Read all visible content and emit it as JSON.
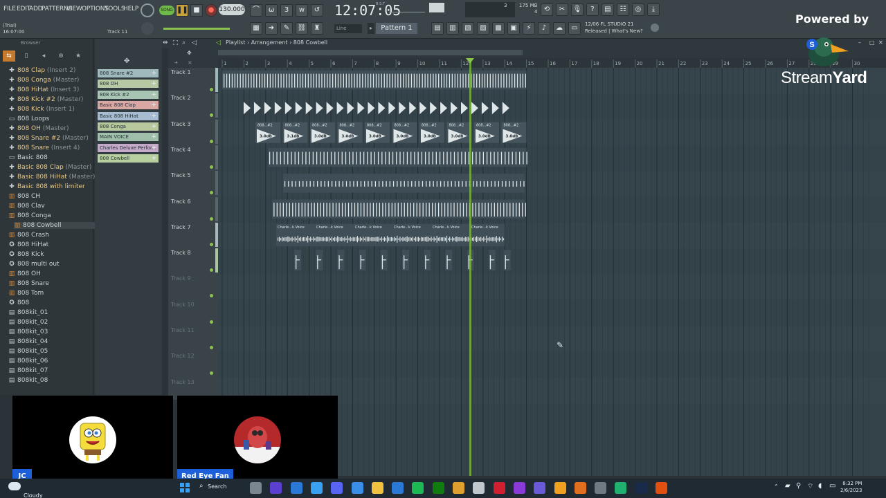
{
  "menu": [
    "FILE",
    "EDIT",
    "ADD",
    "PATTERNS",
    "VIEW",
    "OPTIONS",
    "TOOLS",
    "HELP"
  ],
  "transport": {
    "song_mode": "SONG",
    "bpm": "130.000",
    "time": "12:07:05",
    "time_sub": "B:S:T"
  },
  "status": {
    "trial": "(Trial)",
    "trial_time": "16:07:00",
    "track_hint": "Track 11",
    "cpu_mem": "175 MB",
    "cpu_val": "4",
    "cpu_extra": "3"
  },
  "pattern": {
    "line_mode": "Line",
    "pattern_name": "Pattern 1"
  },
  "news": {
    "line1": "12/06  FL STUDIO 21",
    "line2": "Released | What's New?"
  },
  "browser": {
    "title": "Browser",
    "items": [
      {
        "icon": "plugin",
        "label": "808 Clap",
        "sub": "(Insert 2)"
      },
      {
        "icon": "plugin",
        "label": "808 Conga",
        "sub": "(Master)"
      },
      {
        "icon": "plugin",
        "label": "808 HiHat",
        "sub": "(Insert 3)"
      },
      {
        "icon": "plugin",
        "label": "808 Kick #2",
        "sub": "(Master)"
      },
      {
        "icon": "plugin",
        "label": "808 Kick",
        "sub": "(Insert 1)"
      },
      {
        "icon": "folder",
        "label": "808 Loops",
        "sub": ""
      },
      {
        "icon": "plugin",
        "label": "808 OH",
        "sub": "(Master)"
      },
      {
        "icon": "plugin",
        "label": "808 Snare #2",
        "sub": "(Master)"
      },
      {
        "icon": "plugin",
        "label": "808 Snare",
        "sub": "(Insert 4)"
      },
      {
        "icon": "folder",
        "label": "Basic 808",
        "sub": ""
      },
      {
        "icon": "plugin",
        "label": "Basic 808 Clap",
        "sub": "(Master)"
      },
      {
        "icon": "plugin",
        "label": "Basic 808 HiHat",
        "sub": "(Master)"
      },
      {
        "icon": "plugin",
        "label": "Basic 808 with limiter",
        "sub": ""
      },
      {
        "icon": "file",
        "label": "808 CH",
        "sub": ""
      },
      {
        "icon": "file",
        "label": "808 Clav",
        "sub": ""
      },
      {
        "icon": "file",
        "label": "808 Conga",
        "sub": ""
      },
      {
        "icon": "file",
        "label": "808 Cowbell",
        "sub": ""
      },
      {
        "icon": "file",
        "label": "808 Crash",
        "sub": ""
      },
      {
        "icon": "plugin2",
        "label": "808 HiHat",
        "sub": ""
      },
      {
        "icon": "plugin2",
        "label": "808 Kick",
        "sub": ""
      },
      {
        "icon": "plugin2",
        "label": "808 multi out",
        "sub": ""
      },
      {
        "icon": "file",
        "label": "808 OH",
        "sub": ""
      },
      {
        "icon": "file",
        "label": "808 Snare",
        "sub": ""
      },
      {
        "icon": "file",
        "label": "808 Tom",
        "sub": ""
      },
      {
        "icon": "plugin2",
        "label": "808",
        "sub": ""
      },
      {
        "icon": "doc",
        "label": "808kit_01",
        "sub": ""
      },
      {
        "icon": "doc",
        "label": "808kit_02",
        "sub": ""
      },
      {
        "icon": "doc",
        "label": "808kit_03",
        "sub": ""
      },
      {
        "icon": "doc",
        "label": "808kit_04",
        "sub": ""
      },
      {
        "icon": "doc",
        "label": "808kit_05",
        "sub": ""
      },
      {
        "icon": "doc",
        "label": "808kit_06",
        "sub": ""
      },
      {
        "icon": "doc",
        "label": "808kit_07",
        "sub": ""
      },
      {
        "icon": "doc",
        "label": "808kit_08",
        "sub": ""
      }
    ],
    "selected": "808 Cowbell"
  },
  "channels": [
    {
      "label": "808 Snare #2",
      "color": "#9fb9bd"
    },
    {
      "label": "808 OH",
      "color": "#b7c8a4"
    },
    {
      "label": "808 Kick #2",
      "color": "#a8c4b3"
    },
    {
      "label": "Basic 808 Clap",
      "color": "#d9a7a4"
    },
    {
      "label": "Basic 808 HiHat",
      "color": "#a7bcd0"
    },
    {
      "label": "808 Conga",
      "color": "#b6c89c"
    },
    {
      "label": "MAIN VOICE",
      "color": "#9fbfaa"
    },
    {
      "label": "Charles Deluxe Perfor...",
      "color": "#c4a9c9"
    },
    {
      "label": "808 Cowbell",
      "color": "#b8cfa0"
    }
  ],
  "playlist": {
    "breadcrumb": "Playlist › Arrangement › 808 Cowbell",
    "ruler": [
      "1",
      "2",
      "3",
      "4",
      "5",
      "6",
      "7",
      "8",
      "9",
      "10",
      "11",
      "12",
      "13",
      "14",
      "15",
      "16",
      "17",
      "18",
      "19",
      "20",
      "21",
      "22",
      "23",
      "24",
      "25",
      "26",
      "27",
      "28",
      "29",
      "30"
    ],
    "tracks": [
      "Track 1",
      "Track 2",
      "Track 3",
      "Track 4",
      "Track 5",
      "Track 6",
      "Track 7",
      "Track 8",
      "Track 9",
      "Track 10",
      "Track 11",
      "Track 12",
      "Track 13"
    ],
    "clip_labels": {
      "track3": "808...#2",
      "track3_db": "3.0dB",
      "track3_db_alt": "3.1dB",
      "track7": "Charle...k Voice"
    }
  },
  "overlay": {
    "powered_by": "Powered by",
    "brand_light": "Stream",
    "brand_bold": "Yard"
  },
  "participants": [
    {
      "initials": "JC",
      "name": ""
    },
    {
      "initials": "",
      "name": "Red Eye Fan"
    }
  ],
  "taskbar": {
    "weather": "Cloudy",
    "search": "Search",
    "time": "8:32 PM",
    "date": "2/6/2023"
  }
}
